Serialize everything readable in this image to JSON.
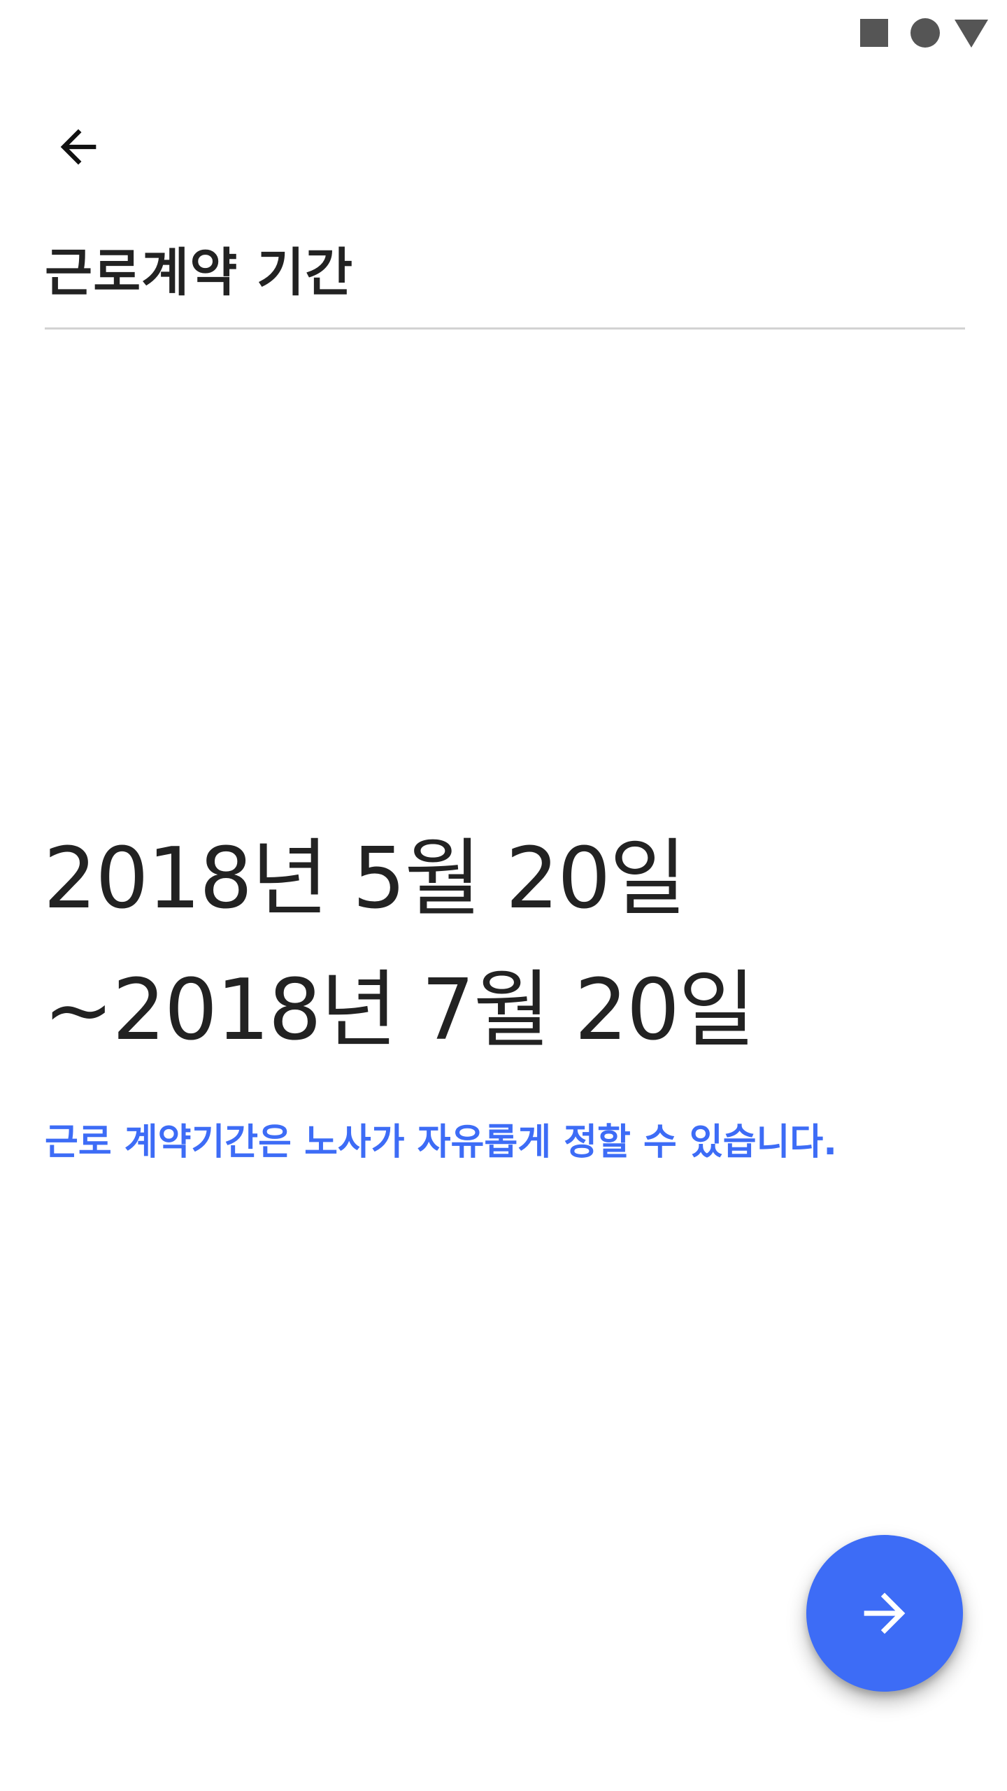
{
  "status_bar": {
    "icons": [
      "square-icon",
      "circle-icon",
      "triangle-icon"
    ],
    "icon_color": "#555555"
  },
  "header": {
    "back_icon": "arrow-left-icon",
    "title": "근로계약 기간"
  },
  "contract_period": {
    "start": "2018년 5월 20일",
    "end": "~2018년 7월 20일"
  },
  "hint": {
    "text": "근로 계약기간은 노사가 자유롭게 정할 수 있습니다.",
    "color": "#3d6cf6"
  },
  "fab": {
    "icon": "arrow-right-icon",
    "color": "#3d6cf6"
  }
}
